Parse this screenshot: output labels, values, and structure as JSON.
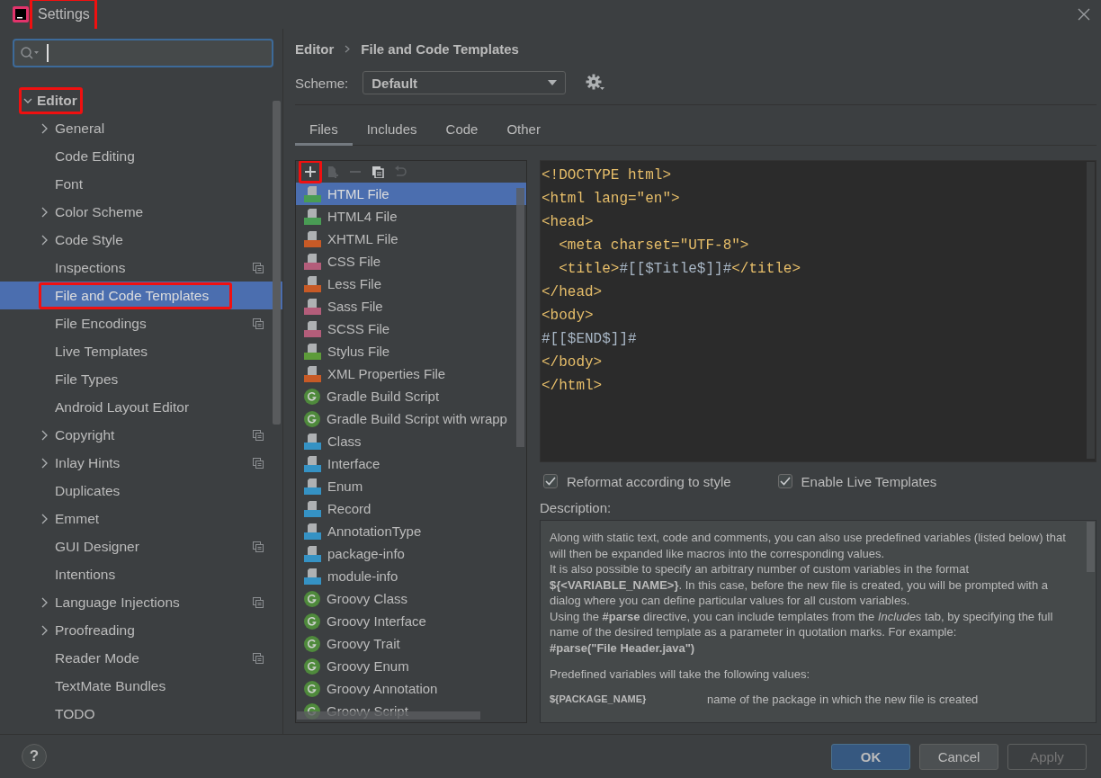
{
  "window": {
    "title": "Settings",
    "title_highlighted": true
  },
  "sidebar": {
    "items": [
      {
        "label": "Editor",
        "expanded": true,
        "selected": false,
        "highlighted": true,
        "children": [
          {
            "label": "General",
            "has_children": true,
            "project_scoped": false,
            "selected": false,
            "highlighted": false
          },
          {
            "label": "Code Editing",
            "has_children": false,
            "project_scoped": false,
            "selected": false,
            "highlighted": false
          },
          {
            "label": "Font",
            "has_children": false,
            "project_scoped": false,
            "selected": false,
            "highlighted": false
          },
          {
            "label": "Color Scheme",
            "has_children": true,
            "project_scoped": false,
            "selected": false,
            "highlighted": false
          },
          {
            "label": "Code Style",
            "has_children": true,
            "project_scoped": false,
            "selected": false,
            "highlighted": false
          },
          {
            "label": "Inspections",
            "has_children": false,
            "project_scoped": true,
            "selected": false,
            "highlighted": false
          },
          {
            "label": "File and Code Templates",
            "has_children": false,
            "project_scoped": false,
            "selected": true,
            "highlighted": true
          },
          {
            "label": "File Encodings",
            "has_children": false,
            "project_scoped": true,
            "selected": false,
            "highlighted": false
          },
          {
            "label": "Live Templates",
            "has_children": false,
            "project_scoped": false,
            "selected": false,
            "highlighted": false
          },
          {
            "label": "File Types",
            "has_children": false,
            "project_scoped": false,
            "selected": false,
            "highlighted": false
          },
          {
            "label": "Android Layout Editor",
            "has_children": false,
            "project_scoped": false,
            "selected": false,
            "highlighted": false
          },
          {
            "label": "Copyright",
            "has_children": true,
            "project_scoped": true,
            "selected": false,
            "highlighted": false
          },
          {
            "label": "Inlay Hints",
            "has_children": true,
            "project_scoped": true,
            "selected": false,
            "highlighted": false
          },
          {
            "label": "Duplicates",
            "has_children": false,
            "project_scoped": false,
            "selected": false,
            "highlighted": false
          },
          {
            "label": "Emmet",
            "has_children": true,
            "project_scoped": false,
            "selected": false,
            "highlighted": false
          },
          {
            "label": "GUI Designer",
            "has_children": false,
            "project_scoped": true,
            "selected": false,
            "highlighted": false
          },
          {
            "label": "Intentions",
            "has_children": false,
            "project_scoped": false,
            "selected": false,
            "highlighted": false
          },
          {
            "label": "Language Injections",
            "has_children": true,
            "project_scoped": true,
            "selected": false,
            "highlighted": false
          },
          {
            "label": "Proofreading",
            "has_children": true,
            "project_scoped": false,
            "selected": false,
            "highlighted": false
          },
          {
            "label": "Reader Mode",
            "has_children": false,
            "project_scoped": true,
            "selected": false,
            "highlighted": false
          },
          {
            "label": "TextMate Bundles",
            "has_children": false,
            "project_scoped": false,
            "selected": false,
            "highlighted": false
          },
          {
            "label": "TODO",
            "has_children": false,
            "project_scoped": false,
            "selected": false,
            "highlighted": false
          }
        ]
      }
    ]
  },
  "breadcrumb": [
    "Editor",
    "File and Code Templates"
  ],
  "scheme": {
    "label": "Scheme:",
    "value": "Default"
  },
  "tabs": [
    {
      "label": "Files",
      "selected": true
    },
    {
      "label": "Includes",
      "selected": false
    },
    {
      "label": "Code",
      "selected": false
    },
    {
      "label": "Other",
      "selected": false
    }
  ],
  "toolbar": [
    {
      "kind": "add",
      "disabled": false,
      "highlighted": true
    },
    {
      "kind": "add-child",
      "disabled": true,
      "highlighted": false
    },
    {
      "kind": "remove",
      "disabled": true,
      "highlighted": false
    },
    {
      "kind": "copy",
      "disabled": false,
      "highlighted": false
    },
    {
      "kind": "reset",
      "disabled": true,
      "highlighted": false
    }
  ],
  "templates": [
    {
      "label": "HTML File",
      "kind": "file",
      "color": "#499c54",
      "selected": true
    },
    {
      "label": "HTML4 File",
      "kind": "file",
      "color": "#499c54",
      "selected": false
    },
    {
      "label": "XHTML File",
      "kind": "file",
      "color": "#c75a26",
      "selected": false
    },
    {
      "label": "CSS File",
      "kind": "file",
      "color": "#b35d7a",
      "selected": false
    },
    {
      "label": "Less File",
      "kind": "file",
      "color": "#c75a26",
      "selected": false
    },
    {
      "label": "Sass File",
      "kind": "file",
      "color": "#b35d7a",
      "selected": false
    },
    {
      "label": "SCSS File",
      "kind": "file",
      "color": "#b35d7a",
      "selected": false
    },
    {
      "label": "Stylus File",
      "kind": "file",
      "color": "#5d9b3a",
      "selected": false
    },
    {
      "label": "XML Properties File",
      "kind": "file",
      "color": "#c75a26",
      "selected": false
    },
    {
      "label": "Gradle Build Script",
      "kind": "circle",
      "color": "#4f8a3c",
      "selected": false
    },
    {
      "label": "Gradle Build Script with wrapp",
      "kind": "circle",
      "color": "#4f8a3c",
      "selected": false
    },
    {
      "label": "Class",
      "kind": "file",
      "color": "#3592c4",
      "selected": false
    },
    {
      "label": "Interface",
      "kind": "file",
      "color": "#3592c4",
      "selected": false
    },
    {
      "label": "Enum",
      "kind": "file",
      "color": "#3592c4",
      "selected": false
    },
    {
      "label": "Record",
      "kind": "file",
      "color": "#3592c4",
      "selected": false
    },
    {
      "label": "AnnotationType",
      "kind": "file",
      "color": "#3592c4",
      "selected": false
    },
    {
      "label": "package-info",
      "kind": "file",
      "color": "#3592c4",
      "selected": false
    },
    {
      "label": "module-info",
      "kind": "file",
      "color": "#3592c4",
      "selected": false
    },
    {
      "label": "Groovy Class",
      "kind": "circle",
      "color": "#4f8a3c",
      "selected": false
    },
    {
      "label": "Groovy Interface",
      "kind": "circle",
      "color": "#4f8a3c",
      "selected": false
    },
    {
      "label": "Groovy Trait",
      "kind": "circle",
      "color": "#4f8a3c",
      "selected": false
    },
    {
      "label": "Groovy Enum",
      "kind": "circle",
      "color": "#4f8a3c",
      "selected": false
    },
    {
      "label": "Groovy Annotation",
      "kind": "circle",
      "color": "#4f8a3c",
      "selected": false
    },
    {
      "label": "Groovy Script",
      "kind": "circle",
      "color": "#4f8a3c",
      "selected": false
    }
  ],
  "code": [
    [
      {
        "text": "<!DOCTYPE html>",
        "kind": "tag"
      }
    ],
    [
      {
        "text": "<html lang=\"en\">",
        "kind": "tag"
      }
    ],
    [
      {
        "text": "<head>",
        "kind": "tag"
      }
    ],
    [
      {
        "text": "  <meta charset=\"UTF-8\">",
        "kind": "tag"
      }
    ],
    [
      {
        "text": "  <title>",
        "kind": "tag"
      },
      {
        "text": "#[[$Title$]]#",
        "kind": "text"
      },
      {
        "text": "</title>",
        "kind": "tag"
      }
    ],
    [
      {
        "text": "</head>",
        "kind": "tag"
      }
    ],
    [
      {
        "text": "<body>",
        "kind": "tag"
      }
    ],
    [
      {
        "text": "#[[$END$]]#",
        "kind": "text"
      }
    ],
    [
      {
        "text": "</body>",
        "kind": "tag"
      }
    ],
    [
      {
        "text": "</html>",
        "kind": "tag"
      }
    ]
  ],
  "options": [
    {
      "label": "Reformat according to style",
      "checked": true
    },
    {
      "label": "Enable Live Templates",
      "checked": true
    }
  ],
  "description": {
    "label": "Description:",
    "paragraphs": [
      {
        "text": "Along with static text, code and comments, you can also use predefined variables (listed below) that will then be expanded like macros into the corresponding values.",
        "kind": "text"
      },
      {
        "text": "It is also possible to specify an arbitrary number of custom variables in the format **${<VARIABLE_NAME>}**. In this case, before the new file is created, you will be prompted with a dialog where you can define particular values for all custom variables.",
        "kind": "text"
      },
      {
        "text": "Using the **#parse** directive, you can include templates from the *Includes* tab, by specifying the full name of the desired template as a parameter in quotation marks. For example:",
        "kind": "text"
      },
      {
        "text": "#parse(\"File Header.java\")",
        "kind": "code"
      },
      {
        "text": "Predefined variables will take the following values:",
        "kind": "gap"
      }
    ],
    "variables": [
      {
        "name": "${PACKAGE_NAME}",
        "meaning": "name of the package in which the new file is created"
      }
    ]
  },
  "help": "?",
  "buttons": [
    {
      "label": "OK",
      "kind": "primary",
      "disabled": false
    },
    {
      "label": "Cancel",
      "kind": "secondary",
      "disabled": false
    },
    {
      "label": "Apply",
      "kind": "secondary",
      "disabled": true
    }
  ]
}
